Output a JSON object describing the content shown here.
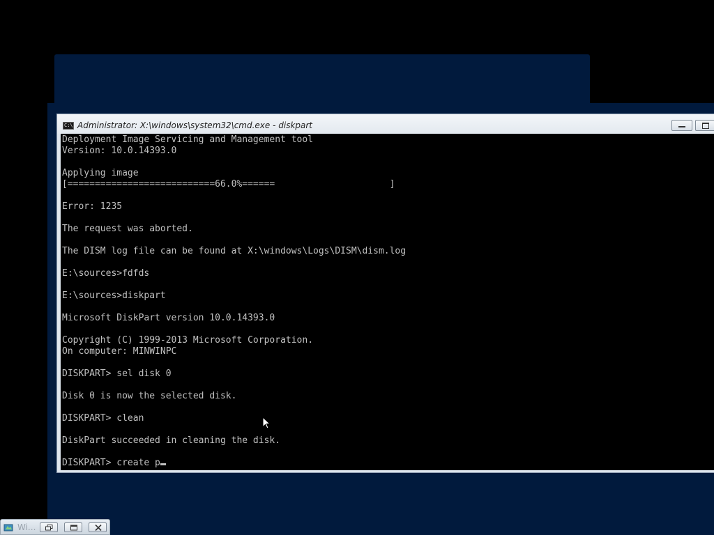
{
  "window": {
    "title": "Administrator: X:\\windows\\system32\\cmd.exe - diskpart",
    "icon_text": "C:\\",
    "icon": "console-icon"
  },
  "console": {
    "lines": [
      "Deployment Image Servicing and Management tool",
      "Version: 10.0.14393.0",
      "",
      "Applying image",
      "[===========================66.0%======                     ]",
      "",
      "Error: 1235",
      "",
      "The request was aborted.",
      "",
      "The DISM log file can be found at X:\\windows\\Logs\\DISM\\dism.log",
      "",
      "E:\\sources>fdfds",
      "",
      "E:\\sources>diskpart",
      "",
      "Microsoft DiskPart version 10.0.14393.0",
      "",
      "Copyright (C) 1999-2013 Microsoft Corporation.",
      "On computer: MINWINPC",
      "",
      "DISKPART> sel disk 0",
      "",
      "Disk 0 is now the selected disk.",
      "",
      "DISKPART> clean",
      "",
      "DiskPart succeeded in cleaning the disk.",
      ""
    ],
    "prompt_line": "DISKPART> create p",
    "progress_percent": 66.0
  },
  "taskbar": {
    "label": "Wi...",
    "icon": "setup-icon"
  },
  "colors": {
    "console_bg": "#000000",
    "console_fg": "#c0c0c0",
    "setup_bg": "#011a3d"
  }
}
